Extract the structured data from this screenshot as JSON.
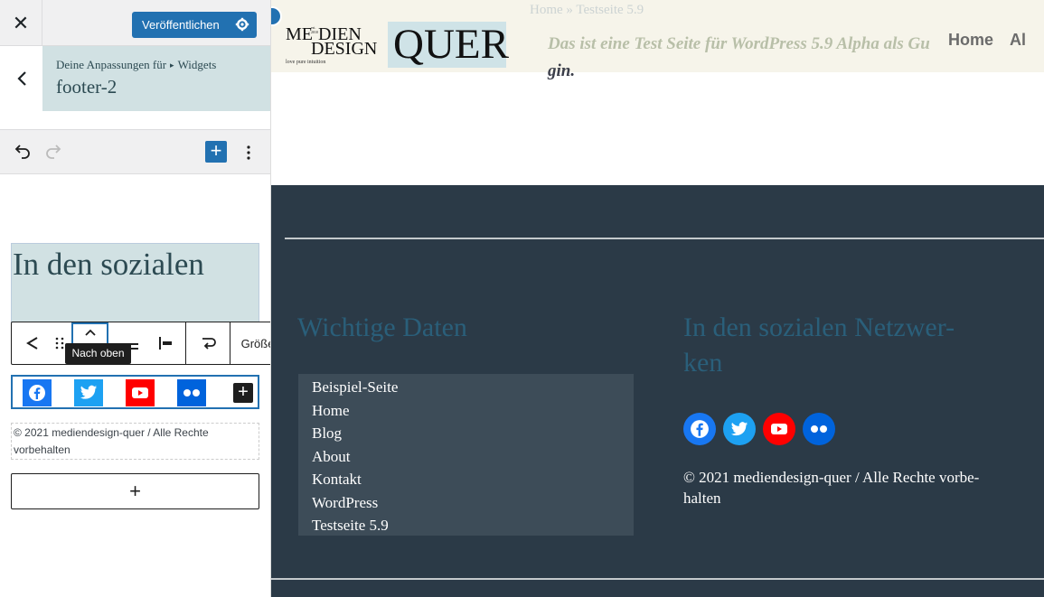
{
  "sidebar": {
    "publish_label": "Veröffentlichen",
    "breadcrumb": {
      "parent": "Deine Anpassungen für",
      "section": "Widgets",
      "title": "footer-2"
    },
    "blocks": {
      "heading_text": "In den sozialen",
      "toolbar": {
        "size_label": "Größe",
        "tooltip": "Nach oben"
      },
      "copyright": "© 2021 mediendesign-quer / Alle Rechte vorbehalten"
    }
  },
  "preview": {
    "logo": {
      "left_text_1": "ME",
      "left_text_2": "DIEN",
      "left_text_3": "DESIGN",
      "est": "est. 2010",
      "tagline": "love pure intuition",
      "quer": "QUER"
    },
    "breadcrumb": "Home » Testseite 5.9",
    "page_subtitle_line1": "Das ist eine Test Seite für WordPress 5.9 Alpha als Gu",
    "page_subtitle_line2": "gin.",
    "nav": [
      "Home",
      "Al"
    ],
    "footer": {
      "col1_title": "Wichtige Daten",
      "menu": [
        "Beispiel-Seite",
        "Home",
        "Blog",
        "About",
        "Kontakt",
        "WordPress",
        "Testseite 5.9"
      ],
      "col2_title_line1": "In den sozialen Netzwer-",
      "col2_title_line2": "ken",
      "copyright_line1": "© 2021 mediendesign-quer / Alle Rechte vorbe-",
      "copyright_line2": "halten"
    }
  },
  "colors": {
    "accent": "#2271b1",
    "facebook": "#1877f2",
    "twitter": "#1da1f2",
    "youtube": "#ff0000",
    "flickr": "#0063dc",
    "footer_bg": "#2b3a47"
  },
  "icons": [
    "close-icon",
    "gear-icon",
    "back-chevron-icon",
    "undo-icon",
    "redo-icon",
    "plus-icon",
    "more-vertical-icon",
    "share-icon",
    "drag-handle-icon",
    "chevron-up-icon",
    "justify-icon",
    "align-left-icon",
    "wrap-icon",
    "facebook-icon",
    "twitter-icon",
    "youtube-icon",
    "flickr-icon"
  ]
}
